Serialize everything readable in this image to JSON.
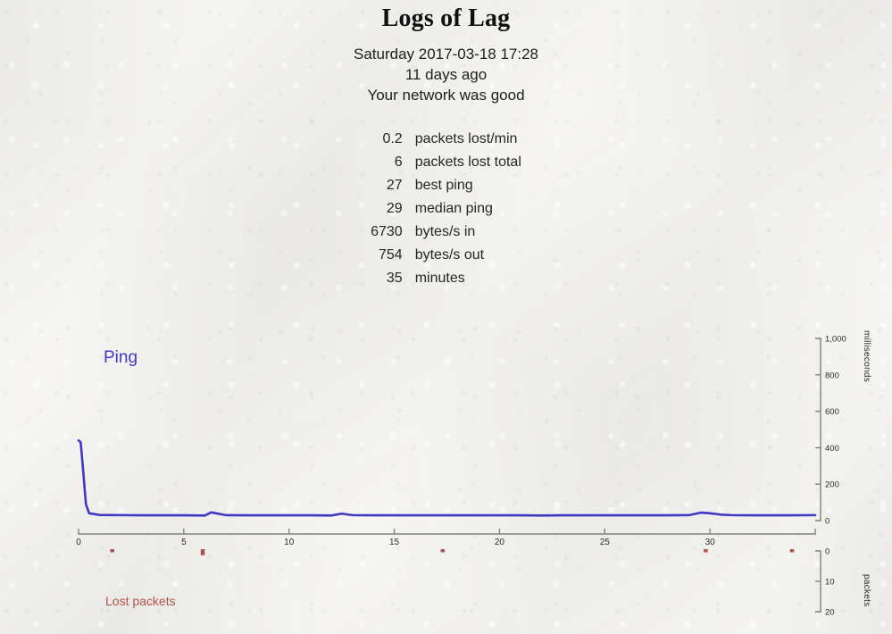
{
  "header": {
    "title": "Logs of Lag",
    "datetime": "Saturday 2017-03-18 17:28",
    "relative_time": "11 days ago",
    "verdict": "Your network was good"
  },
  "stats": [
    {
      "value": "0.2",
      "label": "packets lost/min"
    },
    {
      "value": "6",
      "label": "packets lost total"
    },
    {
      "value": "27",
      "label": "best ping"
    },
    {
      "value": "29",
      "label": "median ping"
    },
    {
      "value": "6730",
      "label": "bytes/s in"
    },
    {
      "value": "754",
      "label": "bytes/s out"
    },
    {
      "value": "35",
      "label": "minutes"
    }
  ],
  "chart_data": {
    "type": "line",
    "title": "Logs of Lag",
    "xlabel": "",
    "x_ticks": [
      0,
      5,
      10,
      15,
      20,
      25,
      30
    ],
    "xlim": [
      0,
      35
    ],
    "series": [
      {
        "name": "Ping",
        "color": "#4038c4",
        "ylabel": "milliseconds",
        "ylim": [
          0,
          1000
        ],
        "y_ticks": [
          0,
          200,
          400,
          600,
          800,
          1000
        ],
        "y_tick_labels": [
          "0",
          "200",
          "400",
          "600",
          "800",
          "1,000"
        ],
        "x": [
          0.0,
          0.1,
          0.2,
          0.35,
          0.5,
          1.0,
          2.0,
          3.0,
          4.0,
          5.0,
          6.0,
          6.3,
          7.0,
          8.0,
          9.0,
          10.0,
          11.0,
          12.0,
          12.5,
          13.0,
          14.0,
          15.0,
          16.0,
          17.0,
          18.0,
          19.0,
          20.0,
          21.0,
          22.0,
          23.0,
          24.0,
          25.0,
          26.0,
          27.0,
          28.0,
          29.0,
          29.6,
          30.0,
          30.5,
          31.0,
          32.0,
          33.0,
          34.0,
          35.0
        ],
        "y": [
          440,
          430,
          300,
          90,
          40,
          31,
          30,
          29,
          29,
          29,
          28,
          45,
          30,
          29,
          29,
          29,
          29,
          28,
          38,
          30,
          29,
          29,
          29,
          29,
          29,
          29,
          29,
          29,
          28,
          29,
          29,
          29,
          29,
          29,
          29,
          30,
          44,
          40,
          33,
          30,
          29,
          29,
          29,
          30
        ]
      },
      {
        "name": "Lost packets",
        "color": "#b0514d",
        "ylabel": "packets",
        "ylim": [
          0,
          20
        ],
        "y_ticks": [
          0,
          10,
          20
        ],
        "y_tick_labels": [
          "0",
          "10",
          "20"
        ],
        "inverted": true,
        "points": [
          {
            "x": 1.6,
            "packets": 1
          },
          {
            "x": 5.9,
            "packets": 2
          },
          {
            "x": 17.3,
            "packets": 1
          },
          {
            "x": 29.8,
            "packets": 1
          },
          {
            "x": 33.9,
            "packets": 1
          }
        ]
      }
    ],
    "legend_position": "in-plot"
  },
  "colors": {
    "background": "#f1f0ec",
    "ping": "#4038c4",
    "lost_packets": "#b0514d",
    "axis": "#808080",
    "text": "#1b1b1b"
  }
}
